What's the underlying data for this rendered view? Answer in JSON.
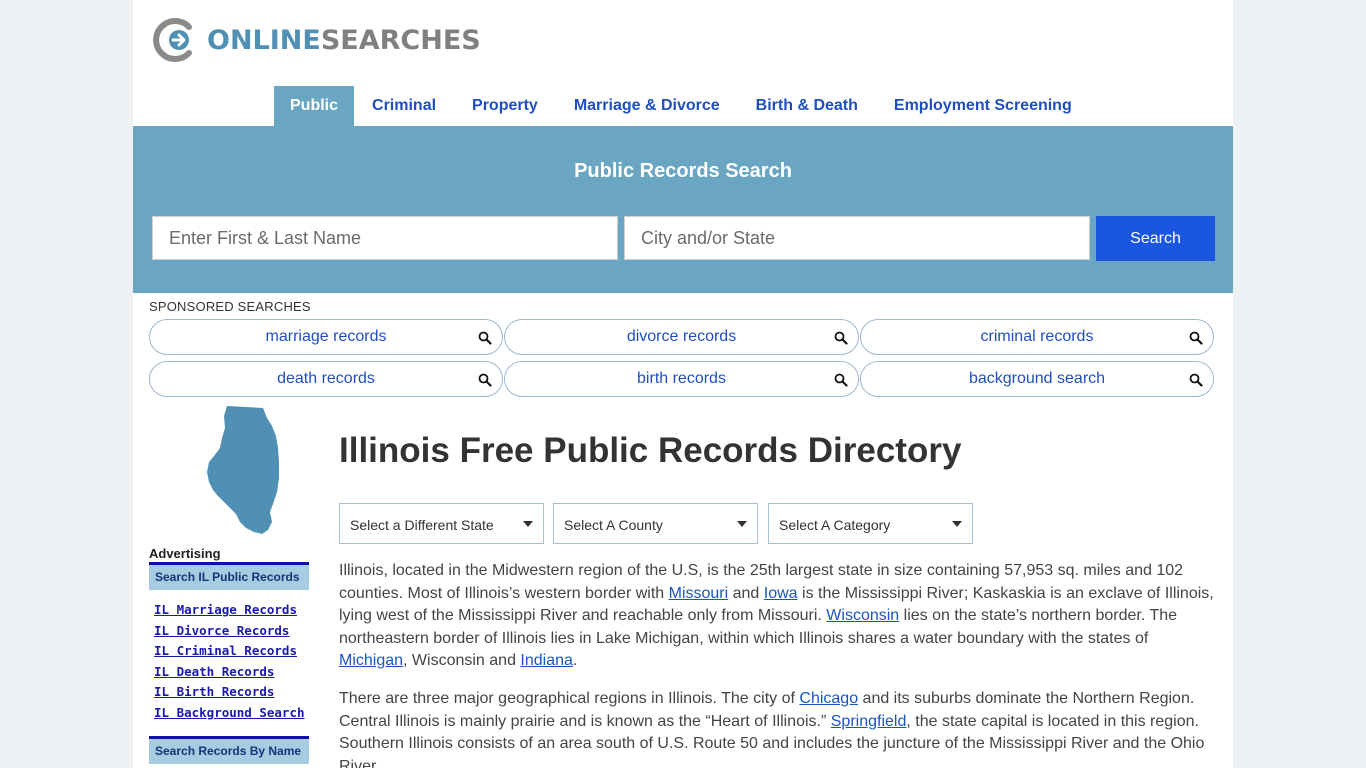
{
  "logo": {
    "part1": "ONLINE",
    "part2": "SEARCHES"
  },
  "nav": [
    {
      "label": "Public",
      "active": true
    },
    {
      "label": "Criminal"
    },
    {
      "label": "Property"
    },
    {
      "label": "Marriage & Divorce"
    },
    {
      "label": "Birth & Death"
    },
    {
      "label": "Employment Screening"
    }
  ],
  "search": {
    "title": "Public Records Search",
    "name_placeholder": "Enter First & Last Name",
    "city_placeholder": "City and/or State",
    "button": "Search"
  },
  "sponsored": {
    "label": "SPONSORED SEARCHES",
    "items": [
      "marriage records",
      "divorce records",
      "criminal records",
      "death records",
      "birth records",
      "background search"
    ]
  },
  "sidebar": {
    "advertising": "Advertising",
    "head1": "Search IL Public Records",
    "links": [
      "IL Marriage Records",
      "IL Divorce Records",
      "IL Criminal Records",
      "IL Death Records",
      "IL Birth Records",
      "IL Background Search"
    ],
    "head2": "Search Records By Name"
  },
  "main": {
    "title": "Illinois Free Public Records Directory",
    "selects": [
      "Select a Different State",
      "Select A County",
      "Select A Category"
    ],
    "p1": {
      "t1": "Illinois, located in the Midwestern region of the U.S, is the 25th largest state in size containing 57,953 sq. miles and 102 counties. Most of Illinois’s western border with ",
      "l1": "Missouri",
      "t2": " and ",
      "l2": "Iowa",
      "t3": " is the Mississippi River; Kaskaskia is an exclave of Illinois, lying west of the Mississippi River and reachable only from Missouri. ",
      "l3": "Wisconsin",
      "t4": " lies on the state’s northern border. The northeastern border of Illinois lies in Lake Michigan, within which Illinois shares a water boundary with the states of ",
      "l4": "Michigan",
      "t5": ", Wisconsin and ",
      "l5": "Indiana",
      "t6": "."
    },
    "p2": {
      "t1": "There are three major geographical regions in Illinois. The city of ",
      "l1": "Chicago",
      "t2": " and its suburbs dominate the Northern Region. Central Illinois is mainly prairie and is known as the “Heart of Illinois.” ",
      "l2": "Springfield",
      "t3": ", the state capital is located in this region. Southern Illinois consists of an area south of U.S. Route 50 and includes the juncture of the Mississippi River and the Ohio River."
    }
  },
  "colors": {
    "brand_blue": "#6aa6c2",
    "link_blue": "#1f4fbf",
    "button_blue": "#1a56e0"
  }
}
